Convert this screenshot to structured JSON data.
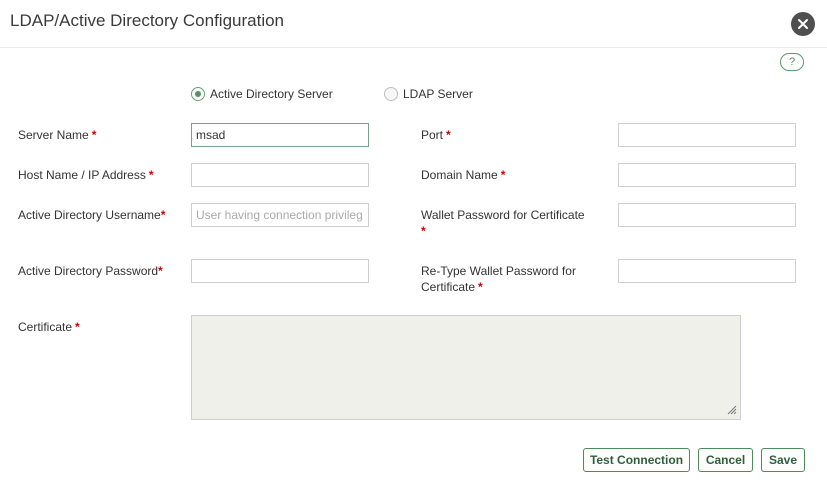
{
  "dialog": {
    "title": "LDAP/Active Directory Configuration",
    "help_label": "?"
  },
  "server_type": {
    "options": [
      "Active Directory Server",
      "LDAP Server"
    ],
    "selected": "Active Directory Server"
  },
  "fields": {
    "server_name": {
      "label": "Server Name",
      "value": "msad"
    },
    "host_name": {
      "label": "Host Name / IP Address",
      "value": ""
    },
    "ad_username": {
      "label": "Active Directory Username",
      "value": "",
      "placeholder": "User having connection privileg"
    },
    "ad_password": {
      "label": "Active Directory Password",
      "value": ""
    },
    "port": {
      "label": "Port",
      "value": ""
    },
    "domain_name": {
      "label": "Domain Name",
      "value": ""
    },
    "wallet_password": {
      "label": "Wallet Password for Certificate",
      "value": ""
    },
    "retype_wallet_password": {
      "label_line1": "Re-Type Wallet Password for",
      "label_line2": "Certificate",
      "value": ""
    },
    "certificate": {
      "label": "Certificate",
      "value": ""
    }
  },
  "required_marker": "*",
  "buttons": {
    "test_connection": "Test Connection",
    "cancel": "Cancel",
    "save": "Save"
  },
  "colors": {
    "accent": "#4f8a5f",
    "required": "#cc0000"
  }
}
